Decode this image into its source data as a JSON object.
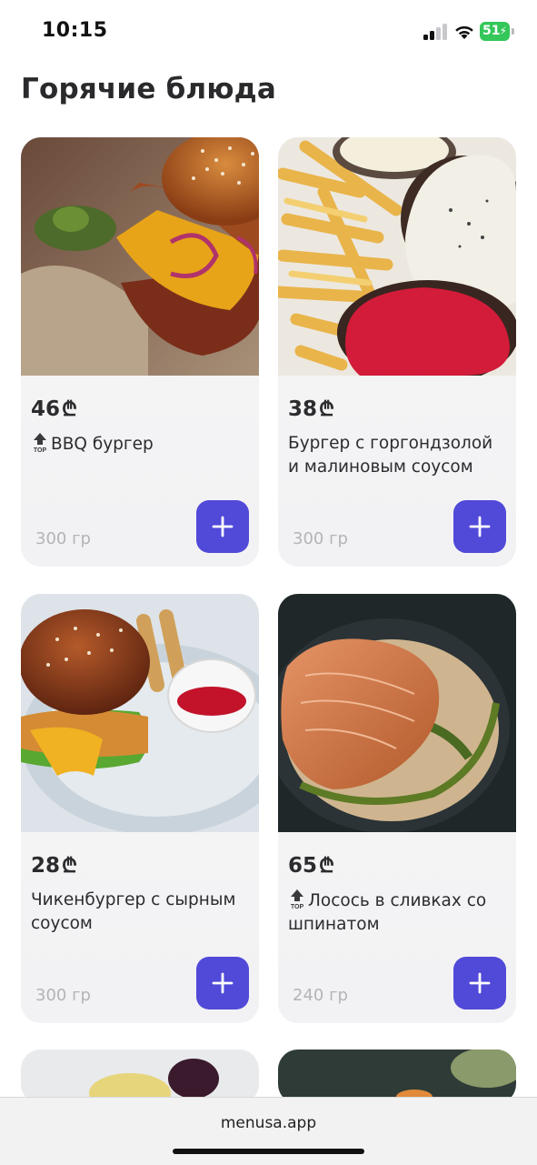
{
  "status_bar": {
    "time": "10:15",
    "battery_level": "51",
    "icons": [
      "signal-icon",
      "wifi-icon",
      "battery-icon"
    ]
  },
  "page": {
    "title": "Горячие блюда"
  },
  "currency_symbol": "₾",
  "dishes": [
    {
      "price": "46",
      "name": "BBQ бургер",
      "top": true,
      "weight": "300 гр",
      "image_icon": "bbq-burger-photo"
    },
    {
      "price": "38",
      "name": "Бургер с горгондзолой и малиновым соусом",
      "top": false,
      "weight": "300 гр",
      "image_icon": "gorgonzola-burger-photo"
    },
    {
      "price": "28",
      "name": "Чикенбургер с сырным соусом",
      "top": false,
      "weight": "300 гр",
      "image_icon": "chicken-burger-photo"
    },
    {
      "price": "65",
      "name": "Лосось в сливках со шпинатом",
      "top": true,
      "weight": "240 гр",
      "image_icon": "salmon-photo"
    }
  ],
  "badge": {
    "label": "TOP"
  },
  "browser": {
    "url": "menusa.app"
  },
  "colors": {
    "accent": "#5149d8",
    "card_bg": "#f4f4f6",
    "battery": "#34c759"
  }
}
